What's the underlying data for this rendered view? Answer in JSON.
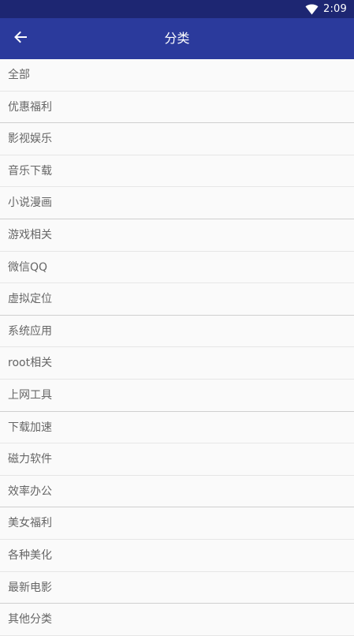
{
  "status_bar": {
    "time": "2:09",
    "wifi_icon": "wifi-icon"
  },
  "app_bar": {
    "title": "分类",
    "back_icon": "arrow-left-icon"
  },
  "categories": [
    "全部",
    "优惠福利",
    "影视娱乐",
    "音乐下载",
    "小说漫画",
    "游戏相关",
    "微信QQ",
    "虚拟定位",
    "系统应用",
    "root相关",
    "上网工具",
    "下载加速",
    "磁力软件",
    "效率办公",
    "美女福利",
    "各种美化",
    "最新电影",
    "其他分类"
  ],
  "colors": {
    "status_bar": "#1d2672",
    "app_bar": "#2b3a9c",
    "background": "#fafafa",
    "text": "#666666"
  }
}
